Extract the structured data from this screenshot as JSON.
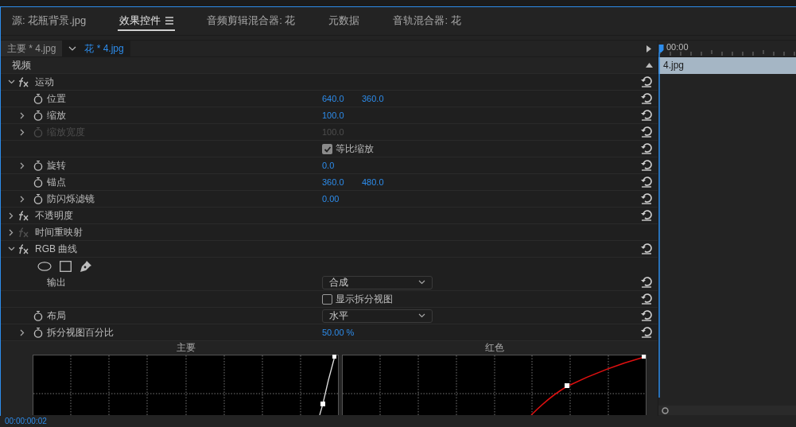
{
  "panel_tabs": [
    {
      "label": "源: 花瓶背景.jpg",
      "selected": false,
      "menu": false
    },
    {
      "label": "效果控件",
      "selected": true,
      "menu": true
    },
    {
      "label": "音频剪辑混合器: 花",
      "selected": false,
      "menu": false
    },
    {
      "label": "元数据",
      "selected": false,
      "menu": false
    },
    {
      "label": "音轨混合器: 花",
      "selected": false,
      "menu": false
    }
  ],
  "clip_tabs": [
    {
      "label": "主要 * 4.jpg",
      "selected": false
    },
    {
      "label": "花 * 4.jpg",
      "selected": true
    }
  ],
  "section": "视频",
  "effects": [
    {
      "name": "运动",
      "expanded": true,
      "fx_active": true,
      "reset": true,
      "children": [
        {
          "kind": "property",
          "label": "位置",
          "values": [
            "640.0",
            "360.0"
          ],
          "chevron": false,
          "disabled": false,
          "reset": true
        },
        {
          "kind": "property",
          "label": "缩放",
          "values": [
            "100.0"
          ],
          "chevron": true,
          "disabled": false,
          "reset": true
        },
        {
          "kind": "property",
          "label": "缩放宽度",
          "values": [
            "100.0"
          ],
          "chevron": true,
          "disabled": true,
          "reset": true
        },
        {
          "kind": "checkbox",
          "label": "等比缩放",
          "checked": true,
          "reset": true
        },
        {
          "kind": "property",
          "label": "旋转",
          "values": [
            "0.0"
          ],
          "chevron": true,
          "disabled": false,
          "reset": true
        },
        {
          "kind": "property",
          "label": "锚点",
          "values": [
            "360.0",
            "480.0"
          ],
          "chevron": false,
          "disabled": false,
          "reset": true
        },
        {
          "kind": "property",
          "label": "防闪烁滤镜",
          "values": [
            "0.00"
          ],
          "chevron": true,
          "disabled": false,
          "reset": true
        }
      ]
    },
    {
      "name": "不透明度",
      "expanded": false,
      "fx_active": true,
      "reset": true
    },
    {
      "name": "时间重映射",
      "expanded": false,
      "fx_active": false,
      "reset": false
    },
    {
      "name": "RGB 曲线",
      "expanded": true,
      "fx_active": true,
      "reset": true,
      "children": [
        {
          "kind": "tools"
        },
        {
          "kind": "dropdown",
          "label": "输出",
          "value": "合成",
          "stopwatch": false,
          "reset": true
        },
        {
          "kind": "checkbox",
          "label": "显示拆分视图",
          "checked": false,
          "reset": true
        },
        {
          "kind": "dropdown",
          "label": "布局",
          "value": "水平",
          "stopwatch": true,
          "reset": true
        },
        {
          "kind": "property",
          "label": "拆分视图百分比",
          "values": [
            "50.00 %"
          ],
          "chevron": true,
          "disabled": false,
          "reset": true
        }
      ]
    }
  ],
  "curves": [
    {
      "title": "主要",
      "kind": "master"
    },
    {
      "title": "红色",
      "kind": "red"
    }
  ],
  "timeline": {
    "ruler": "00:00",
    "clip": "4.jpg"
  },
  "status_bar": {
    "timecode": "00:00:00:02"
  }
}
